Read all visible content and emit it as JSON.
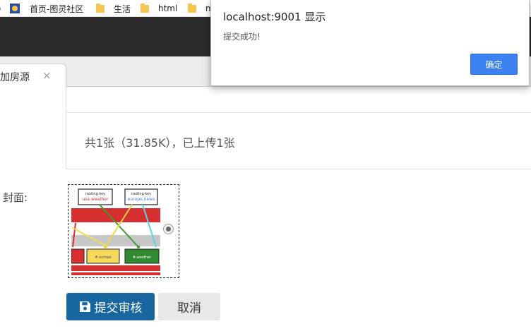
{
  "bookmarks": {
    "items": [
      {
        "label": "首页-图灵社区",
        "icon": "site-icon"
      },
      {
        "label": "生活",
        "icon": "folder-icon"
      },
      {
        "label": "html",
        "icon": "folder-icon"
      },
      {
        "label": "m",
        "icon": "folder-icon"
      }
    ]
  },
  "tab": {
    "label": "加房源",
    "close": "×"
  },
  "uploader": {
    "status": "共1张（31.85K），已上传1张"
  },
  "cover": {
    "label": "封面:"
  },
  "buttons": {
    "submit": "提交审核",
    "cancel": "取消"
  },
  "dialog": {
    "title": "localhost:9001 显示",
    "message": "提交成功!",
    "ok": "确定"
  },
  "thumbnail": {
    "top_left_card": "routing key",
    "top_left_value": "usa.weather",
    "top_right_card": "routing key",
    "top_right_value": "europe.news",
    "bottom_middle": "#.europe",
    "bottom_right": "#.weather"
  },
  "colors": {
    "primary": "#17669f",
    "dialog_button": "#3b82f0",
    "header_dark": "#2b2b2b"
  }
}
